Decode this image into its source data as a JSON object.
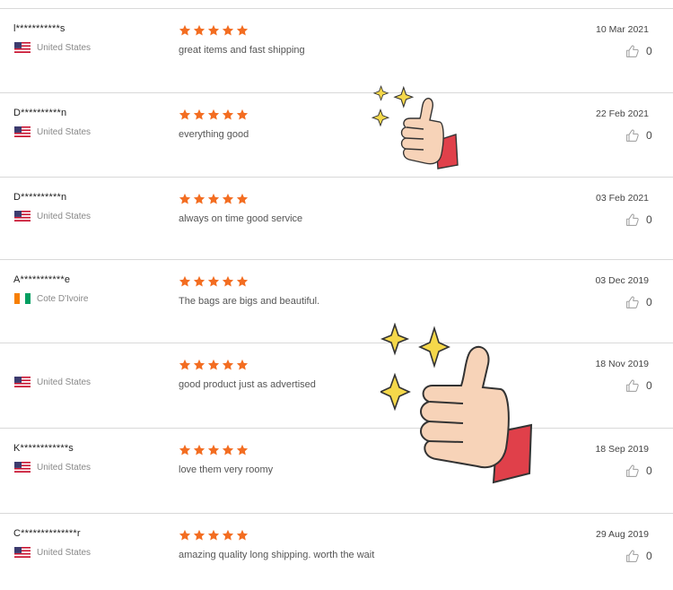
{
  "colors": {
    "star": "#f36d21",
    "divider": "#d9d9d9",
    "cuff": "#e0404a",
    "skin": "#f7d3b8",
    "sparkle": "#f5d84a"
  },
  "icons": {
    "rating": "star-icon",
    "like": "thumbs-up-icon",
    "sticker": "thumbs-up-sticker"
  },
  "reviews": [
    {
      "name": "l***********s",
      "country": "United States",
      "flag": "us",
      "rating": 5,
      "comment": "great items and fast shipping",
      "date": "10 Mar 2021",
      "likes": "0"
    },
    {
      "name": "D**********n",
      "country": "United States",
      "flag": "us",
      "rating": 5,
      "comment": "everything good",
      "date": "22 Feb 2021",
      "likes": "0"
    },
    {
      "name": "D**********n",
      "country": "United States",
      "flag": "us",
      "rating": 5,
      "comment": "always on time good service",
      "date": "03 Feb 2021",
      "likes": "0"
    },
    {
      "name": "A***********e",
      "country": "Cote D'Ivoire",
      "flag": "ci",
      "rating": 5,
      "comment": "The bags are bigs and beautiful.",
      "date": "03 Dec 2019",
      "likes": "0"
    },
    {
      "name": "",
      "country": "United States",
      "flag": "us",
      "rating": 5,
      "comment": "good product just as advertised",
      "date": "18 Nov 2019",
      "likes": "0"
    },
    {
      "name": "K************s",
      "country": "United States",
      "flag": "us",
      "rating": 5,
      "comment": "love them very roomy",
      "date": "18 Sep 2019",
      "likes": "0"
    },
    {
      "name": "C**************r",
      "country": "United States",
      "flag": "us",
      "rating": 5,
      "comment": "amazing quality long shipping. worth the wait",
      "date": "29 Aug 2019",
      "likes": "0"
    }
  ]
}
